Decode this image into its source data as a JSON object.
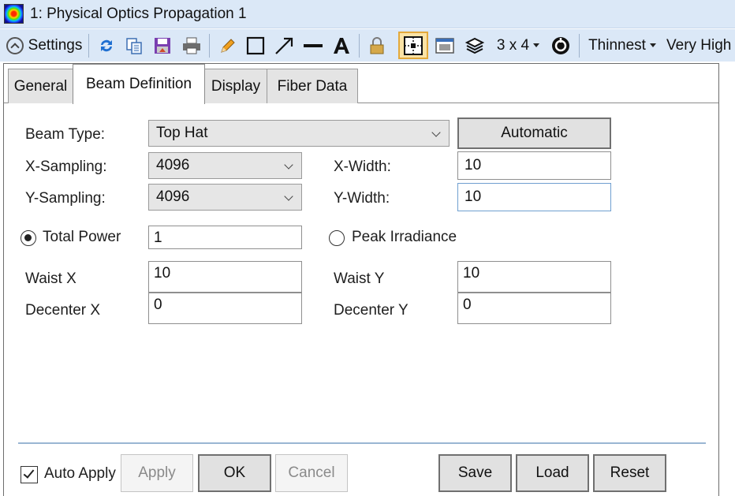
{
  "window": {
    "title": "1: Physical Optics Propagation 1"
  },
  "toolbar": {
    "settings_label": "Settings",
    "layout_label": "3 x 4",
    "line_thickness_label": "Thinnest",
    "quality_label": "Very High",
    "icons": [
      "refresh-icon",
      "copy-icon",
      "save-icon",
      "print-icon",
      "pencil-icon",
      "rectangle-icon",
      "arrow-icon",
      "line-icon",
      "text-icon",
      "lock-icon",
      "grid-icon",
      "window-icon",
      "layers-icon",
      "target-icon"
    ]
  },
  "tabs": [
    {
      "label": "General"
    },
    {
      "label": "Beam Definition"
    },
    {
      "label": "Display"
    },
    {
      "label": "Fiber Data"
    }
  ],
  "form": {
    "beam_type_label": "Beam Type:",
    "beam_type_value": "Top Hat",
    "automatic_button": "Automatic",
    "x_sampling_label": "X-Sampling:",
    "x_sampling_value": "4096",
    "y_sampling_label": "Y-Sampling:",
    "y_sampling_value": "4096",
    "x_width_label": "X-Width:",
    "x_width_value": "10",
    "y_width_label": "Y-Width:",
    "y_width_value": "10",
    "total_power_label": "Total Power",
    "total_power_value": "1",
    "peak_irradiance_label": "Peak Irradiance",
    "normalization_selected": "Total Power",
    "waist_x_label": "Waist X",
    "waist_x_value": "10",
    "waist_y_label": "Waist Y",
    "waist_y_value": "10",
    "decenter_x_label": "Decenter X",
    "decenter_x_value": "0",
    "decenter_y_label": "Decenter Y",
    "decenter_y_value": "0"
  },
  "footer": {
    "auto_apply_label": "Auto Apply",
    "auto_apply_checked": true,
    "apply_button": "Apply",
    "ok_button": "OK",
    "cancel_button": "Cancel",
    "save_button": "Save",
    "load_button": "Load",
    "reset_button": "Reset"
  },
  "colors": {
    "toolbar_bg": "#dbe8f7",
    "active_tool_bg": "#fbe3a6",
    "divider": "#9ab6d3"
  }
}
